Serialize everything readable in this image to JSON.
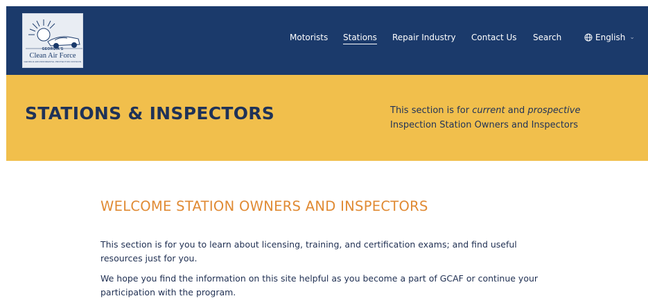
{
  "logo": {
    "small_text": "GEORGIA'S",
    "name": "Clean Air Force",
    "tagline": "GEORGIA ENVIRONMENTAL PROTECTION DIVISION"
  },
  "nav": {
    "items": [
      {
        "label": "Motorists"
      },
      {
        "label": "Stations"
      },
      {
        "label": "Repair Industry"
      },
      {
        "label": "Contact Us"
      },
      {
        "label": "Search"
      }
    ],
    "language": "English"
  },
  "banner": {
    "title": "STATIONS & INSPECTORS",
    "desc_part1": "This section is for ",
    "desc_em1": "current",
    "desc_part2": " and ",
    "desc_em2": "prospective",
    "desc_part3": " Inspection Station Owners and Inspectors"
  },
  "main": {
    "heading": "WELCOME STATION OWNERS AND INSPECTORS",
    "paragraph1": "This section is for you to learn about licensing, training, and certification exams; and find useful resources just for you.",
    "paragraph2": "We hope you find the information on this site helpful as you become a part of GCAF or continue your participation with the program."
  },
  "colors": {
    "header_bg": "#1b3a6b",
    "banner_bg": "#f1bf4c",
    "heading_accent": "#e08a33",
    "text_dark": "#1f2f52"
  }
}
